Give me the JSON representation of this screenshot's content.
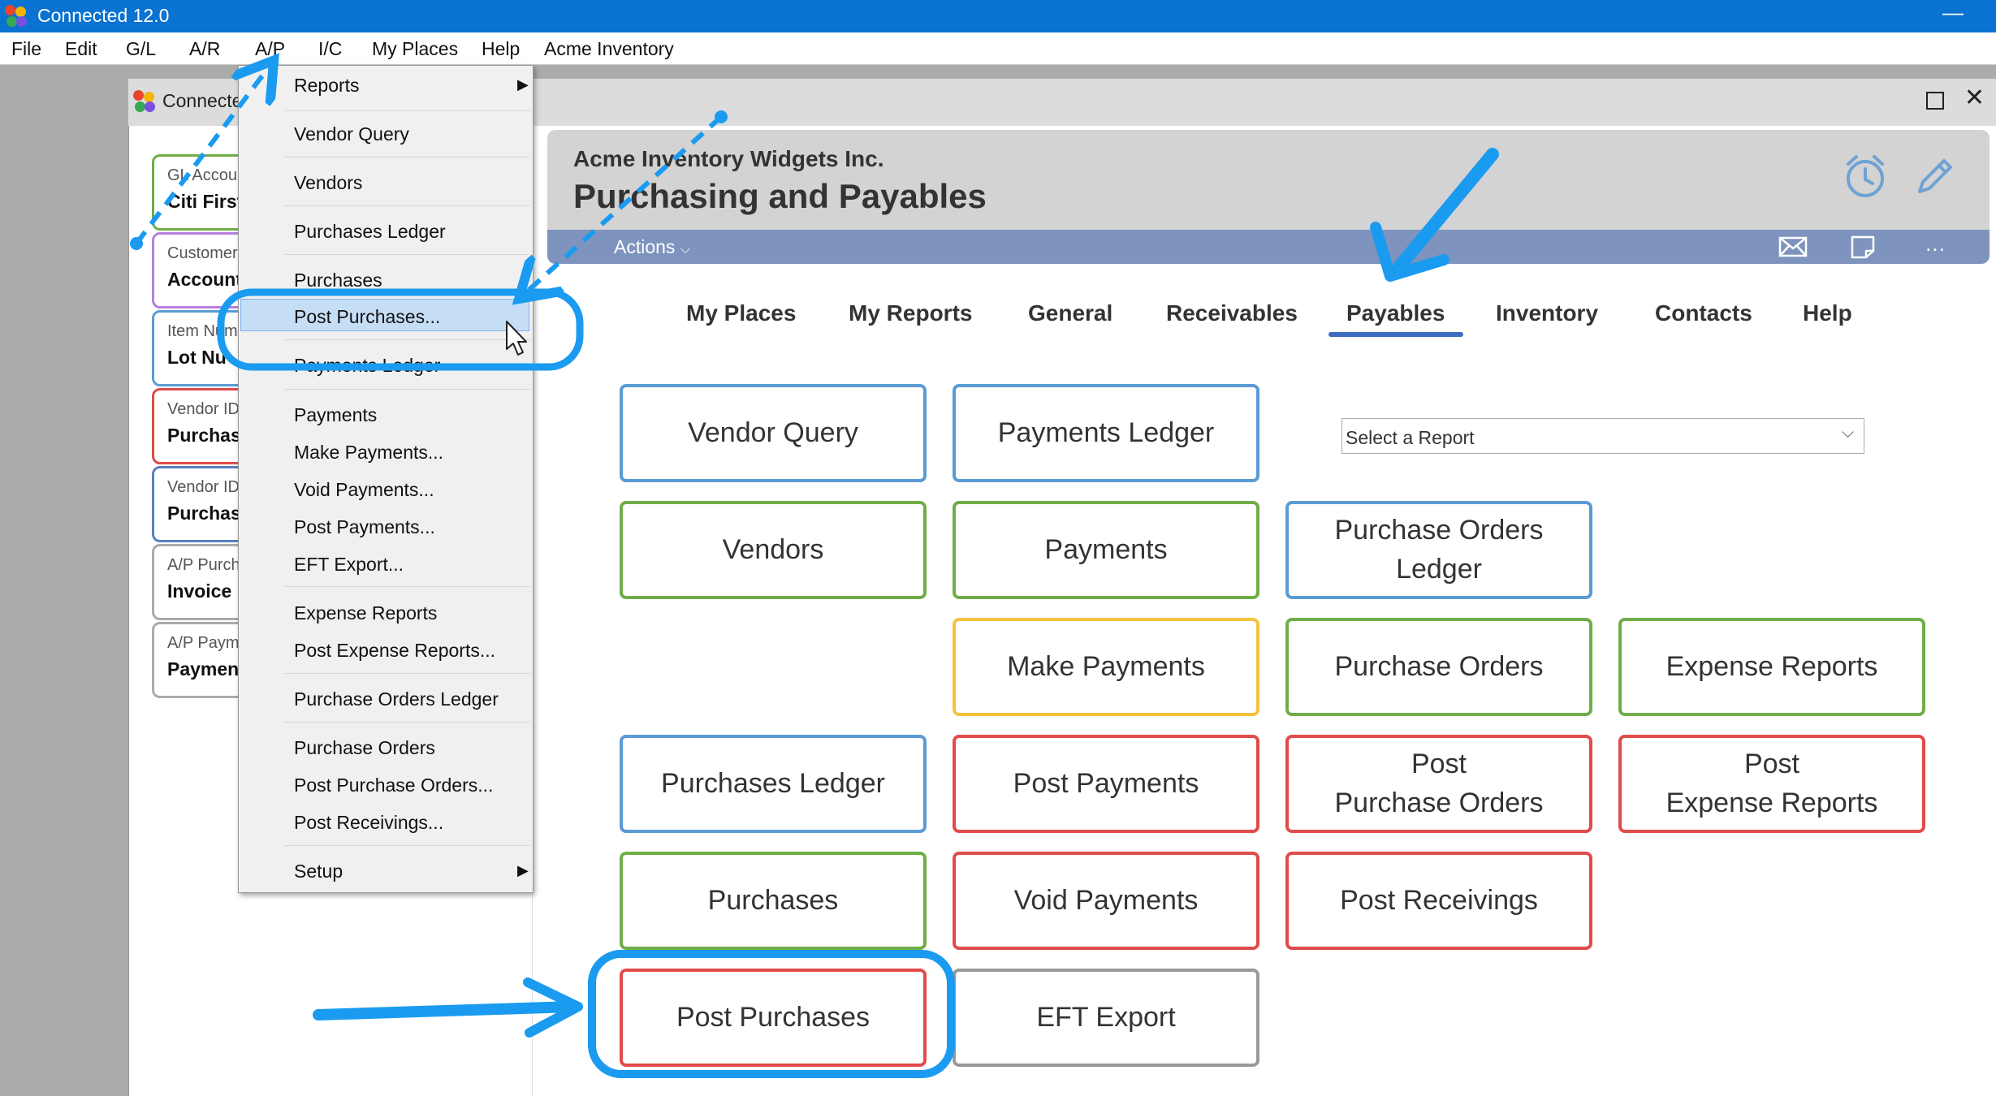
{
  "app": {
    "title": "Connected 12.0",
    "minimize": "—"
  },
  "menubar": [
    "File",
    "Edit",
    "G/L",
    "A/R",
    "A/P",
    "I/C",
    "My Places",
    "Help",
    "Acme Inventory"
  ],
  "inner_window": {
    "title": "Connected",
    "close": "✕"
  },
  "places": [
    {
      "small": "GL Accou",
      "big": "Citi First",
      "color": "#70ad47"
    },
    {
      "small": "Customer",
      "big": "Account",
      "color": "#b57fe0"
    },
    {
      "small": "Item Num",
      "big": "Lot Nu",
      "color": "#5b9bd5"
    },
    {
      "small": "Vendor ID",
      "big": "Purchas",
      "color": "#e04b4b"
    },
    {
      "small": "Vendor ID",
      "big": "Purchas",
      "color": "#5b7fc0"
    },
    {
      "small": "A/P Purch",
      "big": "Invoice",
      "color": "#aaaaaa"
    },
    {
      "small": "A/P Paym",
      "big": "Paymen",
      "color": "#aaaaaa"
    }
  ],
  "header": {
    "company": "Acme Inventory Widgets Inc.",
    "title": "Purchasing and Payables"
  },
  "actions_label": "Actions",
  "tabs": [
    "My Places",
    "My Reports",
    "General",
    "Receivables",
    "Payables",
    "Inventory",
    "Contacts",
    "Help"
  ],
  "active_tab": "Payables",
  "report_select": {
    "value": "Select a Report"
  },
  "buttons": [
    {
      "label": "Vendor Query",
      "color": "blue"
    },
    {
      "label": "Payments Ledger",
      "color": "blue"
    },
    {
      "label": "Vendors",
      "color": "green"
    },
    {
      "label": "Payments",
      "color": "green"
    },
    {
      "label": "Purchase Orders\nLedger",
      "color": "blue"
    },
    {
      "label": "Make Payments",
      "color": "yellow"
    },
    {
      "label": "Purchase Orders",
      "color": "green"
    },
    {
      "label": "Expense Reports",
      "color": "green"
    },
    {
      "label": "Purchases Ledger",
      "color": "blue"
    },
    {
      "label": "Post Payments",
      "color": "red"
    },
    {
      "label": "Post\nPurchase Orders",
      "color": "red"
    },
    {
      "label": "Post\nExpense Reports",
      "color": "red"
    },
    {
      "label": "Purchases",
      "color": "green"
    },
    {
      "label": "Void Payments",
      "color": "red"
    },
    {
      "label": "Post Receivings",
      "color": "red"
    },
    {
      "label": "Post Purchases",
      "color": "red"
    },
    {
      "label": "EFT Export",
      "color": "gray"
    }
  ],
  "dropdown": {
    "items": [
      "Reports",
      "Vendor Query",
      "Vendors",
      "Purchases Ledger",
      "Purchases",
      "Post Purchases...",
      "Payments Ledger",
      "Payments",
      "Make Payments...",
      "Void Payments...",
      "Post Payments...",
      "EFT Export...",
      "Expense Reports",
      "Post Expense Reports...",
      "Purchase Orders Ledger",
      "Purchase Orders",
      "Post Purchase Orders...",
      "Post Receivings...",
      "Setup"
    ],
    "highlighted": "Post Purchases...",
    "submenu_arrow": "▶"
  },
  "colors": {
    "accent_blue": "#1a9bf0",
    "titlebar": "#0a72d1",
    "tab_underline": "#3d6bc0",
    "actions_bar": "#7e93bd"
  },
  "icons": [
    "alarm-clock-icon",
    "pencil-icon",
    "envelope-icon",
    "note-icon",
    "more-icon",
    "chevron-down-icon",
    "mouse-cursor-icon"
  ]
}
